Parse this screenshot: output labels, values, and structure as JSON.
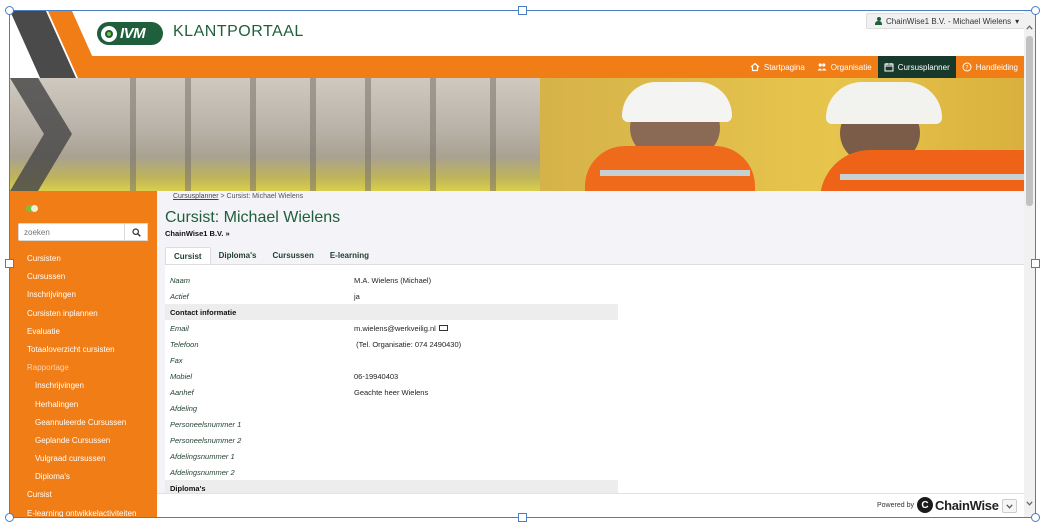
{
  "header": {
    "logo_text": "IVM",
    "brand": "KLANTPORTAAL",
    "user_menu": "ChainWise1 B.V. - Michael Wielens"
  },
  "nav": {
    "items": [
      {
        "label": "Startpagina",
        "icon": "home-icon"
      },
      {
        "label": "Organisatie",
        "icon": "users-icon"
      },
      {
        "label": "Cursusplanner",
        "icon": "calendar-icon",
        "active": true
      },
      {
        "label": "Handleiding",
        "icon": "help-circle-icon"
      }
    ]
  },
  "sidebar": {
    "search_placeholder": "zoeken",
    "items": [
      {
        "label": "Cursisten"
      },
      {
        "label": "Cursussen"
      },
      {
        "label": "Inschrijvingen"
      },
      {
        "label": "Cursisten inplannen"
      },
      {
        "label": "Evaluatie"
      },
      {
        "label": "Totaaloverzicht cursisten"
      },
      {
        "label": "Rapportage"
      },
      {
        "label": "Inschrijvingen"
      },
      {
        "label": "Herhalingen"
      },
      {
        "label": "Geannuleerde Cursussen"
      },
      {
        "label": "Geplande Cursussen"
      },
      {
        "label": "Vulgraad cursussen"
      },
      {
        "label": "Diploma's"
      },
      {
        "label": "Cursist"
      },
      {
        "label": "E-learning ontwikkelactiviteiten"
      }
    ]
  },
  "main": {
    "breadcrumb_link": "Cursusplanner",
    "breadcrumb_sep": " > ",
    "breadcrumb_current": "Cursist: Michael Wielens",
    "title": "Cursist: Michael Wielens",
    "company": "ChainWise1 B.V. »",
    "tabs": [
      {
        "label": "Cursist",
        "active": true
      },
      {
        "label": "Diploma's"
      },
      {
        "label": "Cursussen"
      },
      {
        "label": "E-learning"
      }
    ],
    "rows": [
      {
        "label": "Naam",
        "value": "M.A. Wielens (Michael)"
      },
      {
        "label": "Actief",
        "value": "ja"
      },
      {
        "label": "Contact informatie",
        "value": ""
      },
      {
        "label": "Email",
        "value": "m.wielens@werkveilig.nl"
      },
      {
        "label": "Telefoon",
        "value": " (Tel. Organisatie: 074 2490430)"
      },
      {
        "label": "Fax",
        "value": ""
      },
      {
        "label": "Mobiel",
        "value": "06-19940403"
      },
      {
        "label": "Aanhef",
        "value": "Geachte heer Wielens"
      },
      {
        "label": "Afdeling",
        "value": ""
      },
      {
        "label": "Personeelsnummer 1",
        "value": ""
      },
      {
        "label": "Personeelsnummer 2",
        "value": ""
      },
      {
        "label": "Afdelingsnummer 1",
        "value": ""
      },
      {
        "label": "Afdelingsnummer 2",
        "value": ""
      },
      {
        "label": "Diploma's",
        "value": ""
      }
    ]
  },
  "footer": {
    "powered_by": "Powered by",
    "brand": "ChainWise",
    "brand_initial": "C"
  },
  "colors": {
    "orange": "#f07d16",
    "dark_green": "#17392b",
    "brand_green": "#1f5f3c",
    "accent_green": "#7bbf3a"
  }
}
